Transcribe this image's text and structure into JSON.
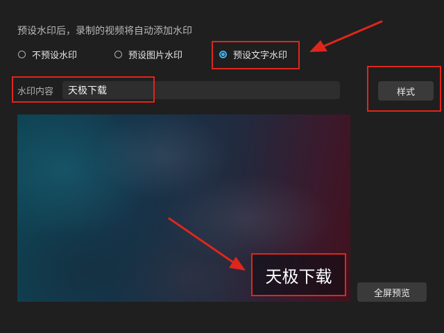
{
  "description": "预设水印后，录制的视频将自动添加水印",
  "watermark_mode": {
    "options": [
      {
        "label": "不预设水印",
        "checked": false
      },
      {
        "label": "预设图片水印",
        "checked": false
      },
      {
        "label": "预设文字水印",
        "checked": true
      }
    ]
  },
  "content_field": {
    "label": "水印内容",
    "value": "天极下载"
  },
  "style_button": {
    "label": "样式"
  },
  "preview": {
    "watermark_text": "天极下载"
  },
  "fullscreen_button": {
    "label": "全屏预览"
  },
  "colors": {
    "accent": "#3fb0ea",
    "highlight": "#e0261b",
    "background": "#1f1f1f"
  }
}
